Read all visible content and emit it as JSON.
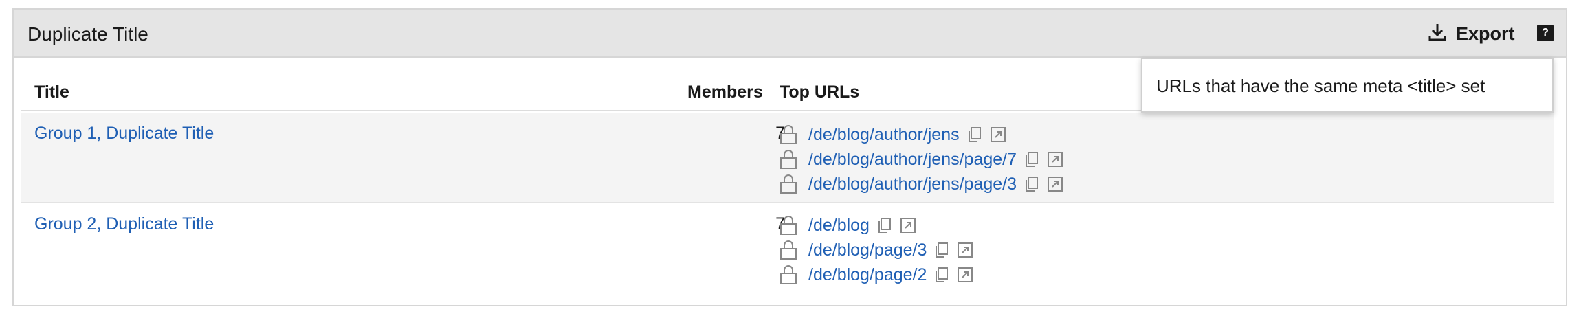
{
  "panel": {
    "title": "Duplicate Title",
    "export_label": "Export",
    "help_label": "?",
    "tooltip": "URLs that have the same meta <title> set"
  },
  "table": {
    "columns": {
      "title": "Title",
      "members": "Members",
      "top_urls": "Top URLs"
    },
    "rows": [
      {
        "title": "Group 1, Duplicate Title",
        "members": "7",
        "urls": [
          "/de/blog/author/jens",
          "/de/blog/author/jens/page/7",
          "/de/blog/author/jens/page/3"
        ]
      },
      {
        "title": "Group 2, Duplicate Title",
        "members": "7",
        "urls": [
          "/de/blog",
          "/de/blog/page/3",
          "/de/blog/page/2"
        ]
      }
    ]
  },
  "icons": {
    "export": "download-icon",
    "lock": "lock-icon",
    "copy": "copy-icon",
    "open": "external-link-icon"
  },
  "colors": {
    "link": "#1f5fb4",
    "header_bg": "#e5e5e5",
    "row_alt": "#f4f4f4"
  }
}
